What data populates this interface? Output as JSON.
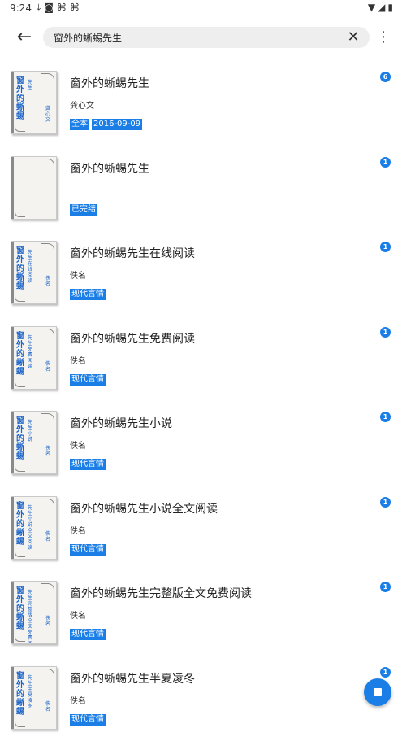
{
  "status_bar": {
    "time": "9:24",
    "left_icons": [
      "download-icon",
      "notification-icon",
      "app-icon",
      "app-icon"
    ],
    "right_icons": [
      "wifi-icon",
      "signal-icon",
      "battery-icon"
    ]
  },
  "search": {
    "query": "窗外的蜥蜴先生",
    "placeholder": ""
  },
  "results": [
    {
      "title": "窗外的蜥蜴先生",
      "author": "龚心文",
      "tags": [
        "全本",
        "2016-09-09"
      ],
      "count": "6",
      "cover": {
        "title": "窗外的蜥蜴",
        "sub": "先生",
        "author": "龚心文"
      }
    },
    {
      "title": "窗外的蜥蜴先生",
      "author": "",
      "tags": [
        "已完结"
      ],
      "count": "1",
      "cover": {
        "title": "",
        "sub": "",
        "author": ""
      }
    },
    {
      "title": "窗外的蜥蜴先生在线阅读",
      "author": "佚名",
      "tags": [
        "现代言情"
      ],
      "count": "1",
      "cover": {
        "title": "窗外的蜥蜴",
        "sub": "先生在线阅读",
        "author": "佚名"
      }
    },
    {
      "title": "窗外的蜥蜴先生免费阅读",
      "author": "佚名",
      "tags": [
        "现代言情"
      ],
      "count": "1",
      "cover": {
        "title": "窗外的蜥蜴",
        "sub": "先生免费阅读",
        "author": "佚名"
      }
    },
    {
      "title": "窗外的蜥蜴先生小说",
      "author": "佚名",
      "tags": [
        "现代言情"
      ],
      "count": "1",
      "cover": {
        "title": "窗外的蜥蜴",
        "sub": "先生小说",
        "author": "佚名"
      }
    },
    {
      "title": "窗外的蜥蜴先生小说全文阅读",
      "author": "佚名",
      "tags": [
        "现代言情"
      ],
      "count": "1",
      "cover": {
        "title": "窗外的蜥蜴",
        "sub": "先生小说全文阅读",
        "author": "佚名"
      }
    },
    {
      "title": "窗外的蜥蜴先生完整版全文免费阅读",
      "author": "佚名",
      "tags": [
        "现代言情"
      ],
      "count": "1",
      "cover": {
        "title": "窗外的蜥蜴",
        "sub": "先生完整版全文免费阅读",
        "author": "佚名"
      }
    },
    {
      "title": "窗外的蜥蜴先生半夏凌冬",
      "author": "佚名",
      "tags": [
        "现代言情"
      ],
      "count": "1",
      "cover": {
        "title": "窗外的蜥蜴",
        "sub": "先生半夏凌冬",
        "author": "佚名"
      }
    }
  ],
  "colors": {
    "accent": "#1a7ee6",
    "cover_text": "#1c64c8",
    "search_bg": "#eeeeee"
  },
  "fab": {
    "icon": "stop-icon"
  }
}
